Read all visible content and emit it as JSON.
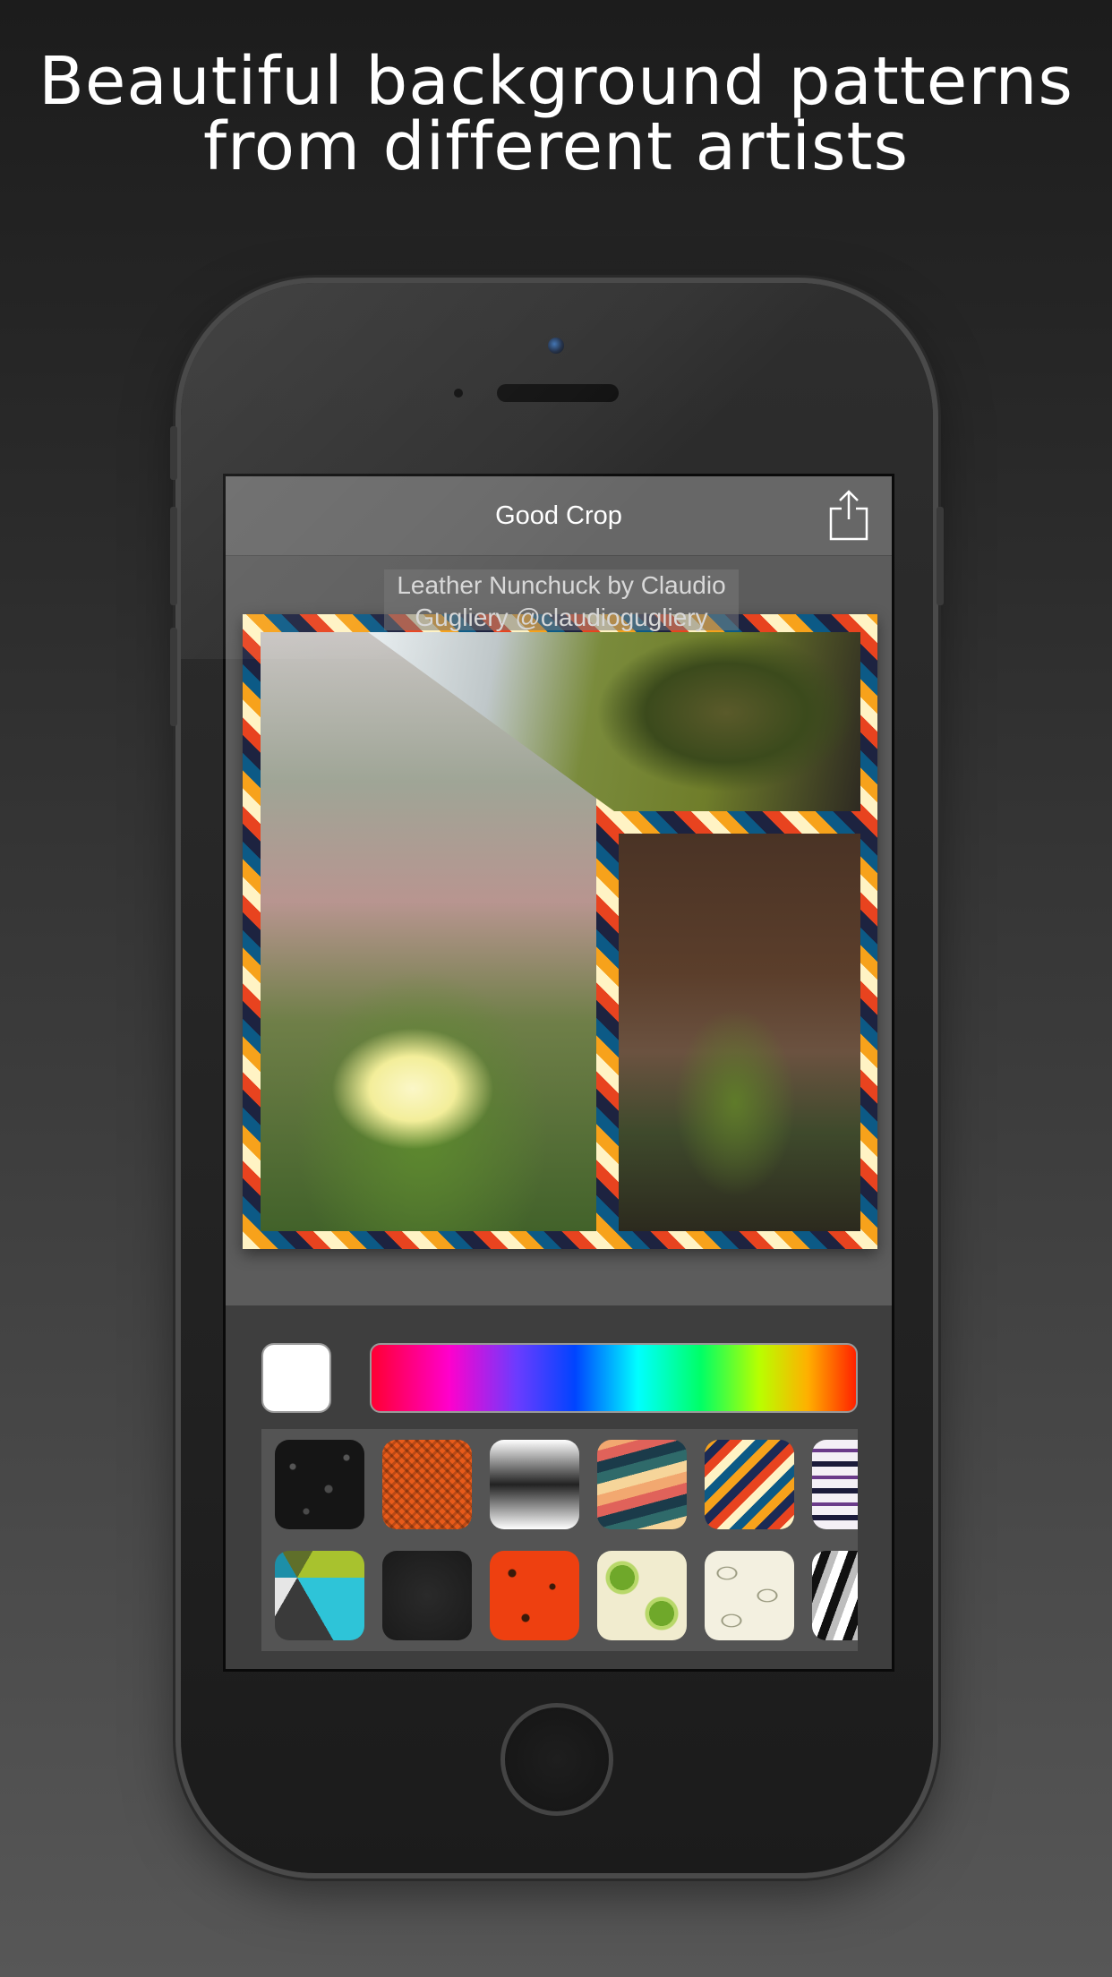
{
  "headline": {
    "line1": "Beautiful background patterns",
    "line2": "from different artists"
  },
  "app": {
    "title": "Good Crop",
    "credit": "Leather Nunchuck by Claudio Gugliery @claudiogugliery"
  },
  "colors": {
    "selected_swatch": "#ffffff",
    "spectrum": [
      "#ff0033",
      "#ff00cc",
      "#6b3cff",
      "#0044ff",
      "#00ffff",
      "#00ff66",
      "#b8ff00",
      "#ffb000",
      "#ff2200"
    ]
  },
  "patterns": {
    "row1": [
      "black-floral",
      "orange-woven",
      "halftone-dots",
      "retro-chevron",
      "tribal-chevron",
      "aztec-knit"
    ],
    "row2": [
      "triangles-mosaic",
      "dark-leather",
      "orange-doodles",
      "kiwi-slices",
      "cream-ovals",
      "zigzag-bw"
    ]
  }
}
